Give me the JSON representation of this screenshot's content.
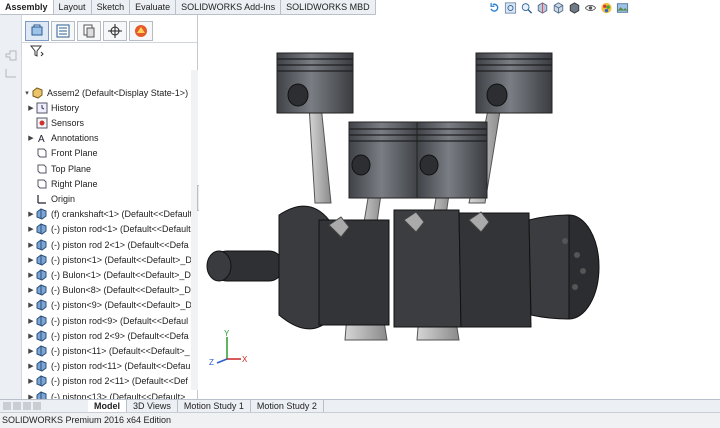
{
  "command_manager": {
    "tabs": [
      "Assembly",
      "Layout",
      "Sketch",
      "Evaluate",
      "SOLIDWORKS Add-Ins",
      "SOLIDWORKS MBD"
    ],
    "active": "Assembly"
  },
  "heads_up_toolbar": {
    "icons": [
      "rotate-icon",
      "zoom-fit-icon",
      "zoom-area-icon",
      "section-view-icon",
      "view-orientation-icon",
      "display-style-icon",
      "hide-show-icon",
      "appearance-icon",
      "scene-icon"
    ]
  },
  "feature_manager": {
    "tab_icons": [
      "feature-manager-icon",
      "property-manager-icon",
      "configuration-manager-icon",
      "dimxpert-icon",
      "display-manager-icon"
    ],
    "filter_icon": "filter-icon",
    "root": "Assem2  (Default<Display State-1>)",
    "items": [
      {
        "label": "History",
        "icon": "history-icon",
        "expandable": true
      },
      {
        "label": "Sensors",
        "icon": "sensors-icon",
        "expandable": false
      },
      {
        "label": "Annotations",
        "icon": "annotations-icon",
        "expandable": true
      },
      {
        "label": "Front Plane",
        "icon": "plane-icon",
        "expandable": false
      },
      {
        "label": "Top Plane",
        "icon": "plane-icon",
        "expandable": false
      },
      {
        "label": "Right Plane",
        "icon": "plane-icon",
        "expandable": false
      },
      {
        "label": "Origin",
        "icon": "origin-icon",
        "expandable": false
      },
      {
        "label": "(f) crankshaft<1> (Default<<Default",
        "icon": "part-icon",
        "expandable": true
      },
      {
        "label": "(-) piston rod<1> (Default<<Default",
        "icon": "part-icon",
        "expandable": true
      },
      {
        "label": "(-) piston rod 2<1> (Default<<Defa",
        "icon": "part-icon",
        "expandable": true
      },
      {
        "label": "(-) piston<1> (Default<<Default>_D",
        "icon": "part-icon",
        "expandable": true
      },
      {
        "label": "(-) Bulon<1> (Default<<Default>_D",
        "icon": "part-icon",
        "expandable": true
      },
      {
        "label": "(-) Bulon<8> (Default<<Default>_D",
        "icon": "part-icon",
        "expandable": true
      },
      {
        "label": "(-) piston<9> (Default<<Default>_D",
        "icon": "part-icon",
        "expandable": true
      },
      {
        "label": "(-) piston rod<9> (Default<<Defaul",
        "icon": "part-icon",
        "expandable": true
      },
      {
        "label": "(-) piston rod 2<9> (Default<<Defa",
        "icon": "part-icon",
        "expandable": true
      },
      {
        "label": "(-) piston<11> (Default<<Default>_",
        "icon": "part-icon",
        "expandable": true
      },
      {
        "label": "(-) piston rod<11> (Default<<Defau",
        "icon": "part-icon",
        "expandable": true
      },
      {
        "label": "(-) piston rod 2<11> (Default<<Def",
        "icon": "part-icon",
        "expandable": true
      },
      {
        "label": "(-) piston<13> (Default<<Default>_",
        "icon": "part-icon",
        "expandable": true
      }
    ]
  },
  "bottom_tabs": {
    "tabs": [
      "Model",
      "3D Views",
      "Motion Study 1",
      "Motion Study 2"
    ],
    "active": "Model"
  },
  "status_bar": {
    "text": "SOLIDWORKS Premium 2016 x64 Edition"
  },
  "triad": {
    "x": "X",
    "y": "Y",
    "z": "Z"
  },
  "colors": {
    "part_dark": "#3a3b3e",
    "piston": "#5c5f64",
    "rod": "#a8a8a8",
    "accent_blue": "#2a7fd4"
  }
}
